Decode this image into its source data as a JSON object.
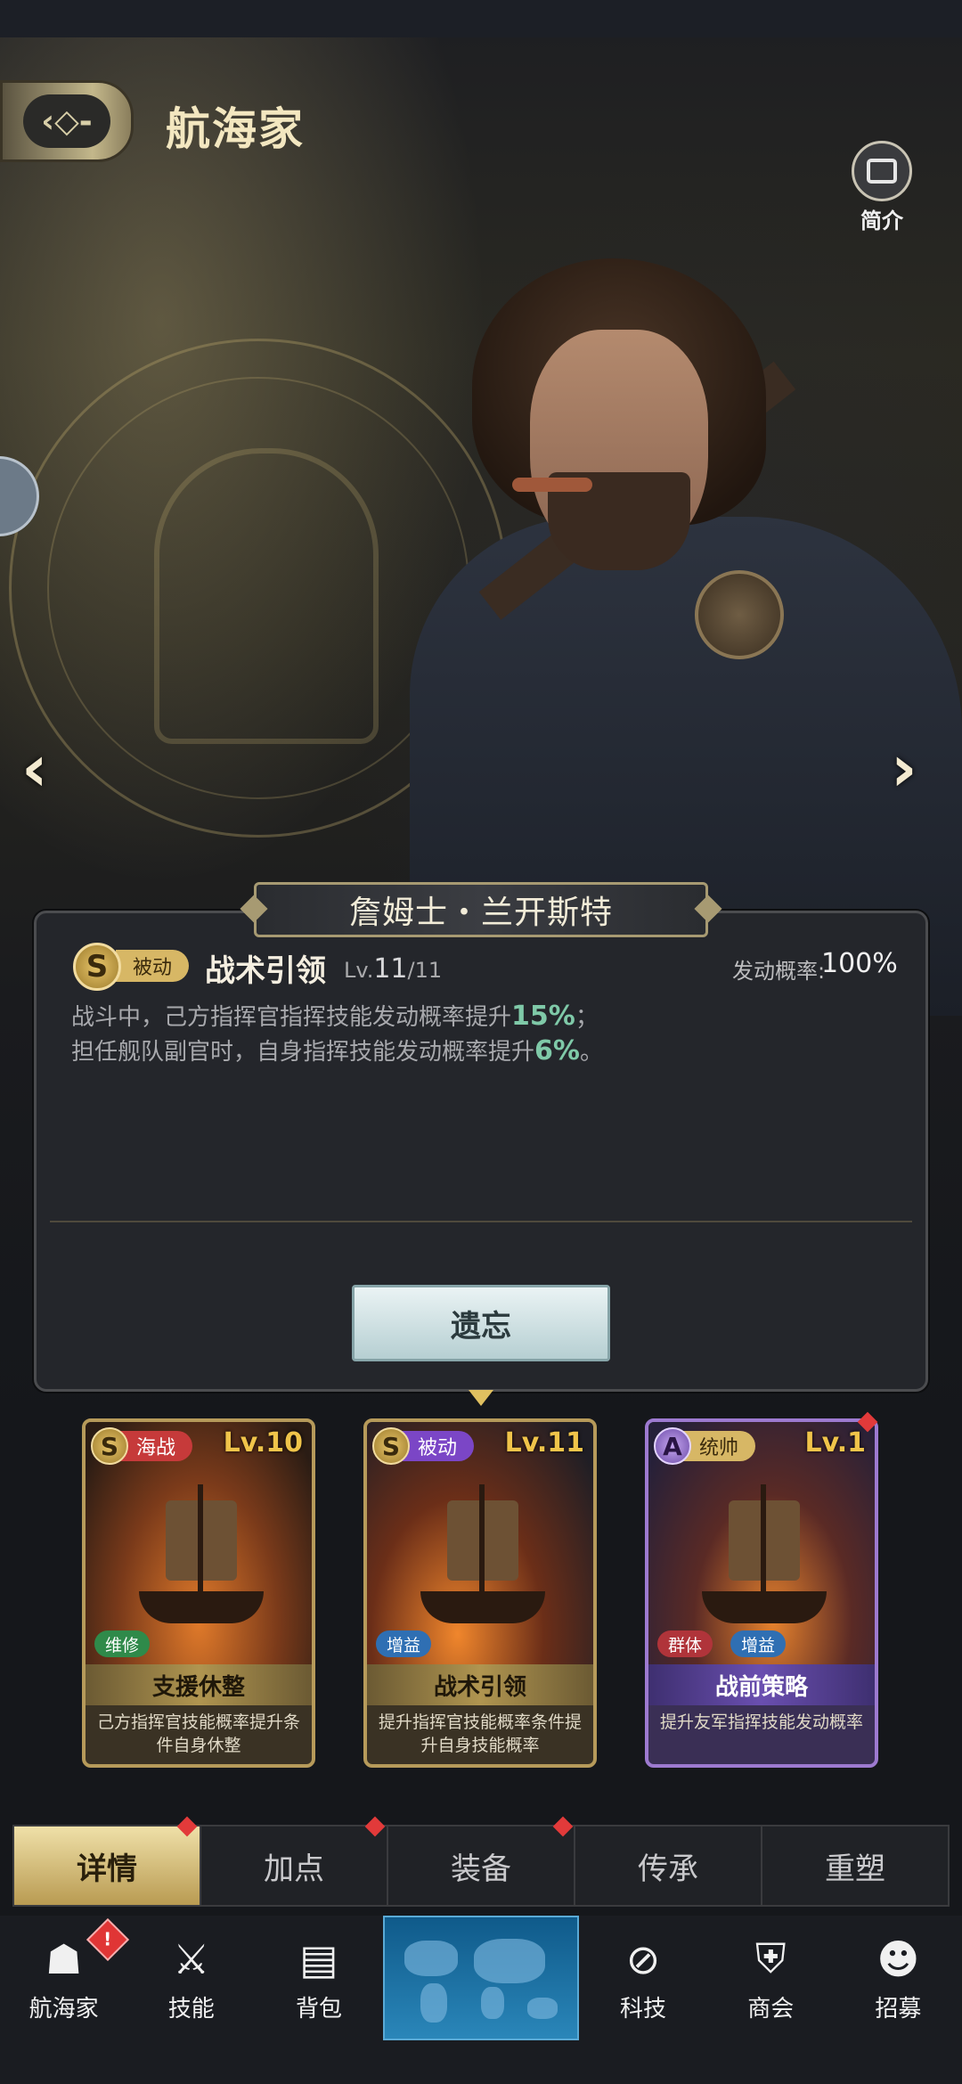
{
  "header": {
    "title": "航海家",
    "intro_label": "简介"
  },
  "commander": {
    "name": "詹姆士・兰开斯特"
  },
  "skill_detail": {
    "grade": "S",
    "type": "被动",
    "name": "战术引领",
    "level_prefix": "Lv.",
    "level": "11",
    "level_max": "/11",
    "rate_label": "发动概率:",
    "rate": "100%",
    "desc_line1_a": "战斗中，己方指挥官指挥技能发动概率提升",
    "desc_line1_val": "15%",
    "desc_line1_b": "；",
    "desc_line2_a": "担任舰队副官时，自身指挥技能发动概率提升",
    "desc_line2_val": "6%",
    "desc_line2_b": "。",
    "forget_button": "遗忘"
  },
  "skill_cards": [
    {
      "grade": "S",
      "type": "海战",
      "level": "Lv.10",
      "tags": [
        "维修"
      ],
      "name": "支援休整",
      "desc": "己方指挥官技能概率提升条件自身休整"
    },
    {
      "grade": "S",
      "type": "被动",
      "level": "Lv.11",
      "tags": [
        "增益"
      ],
      "name": "战术引领",
      "desc": "提升指挥官技能概率条件提升自身技能概率"
    },
    {
      "grade": "A",
      "type": "统帅",
      "level": "Lv.1",
      "tags": [
        "群体",
        "增益"
      ],
      "name": "战前策略",
      "desc": "提升友军指挥技能发动概率"
    }
  ],
  "tabs": [
    "详情",
    "加点",
    "装备",
    "传承",
    "重塑"
  ],
  "active_tab": "详情",
  "bottom_nav": [
    {
      "label": "航海家",
      "icon": "captain-hat-icon"
    },
    {
      "label": "技能",
      "icon": "crossed-swords-icon"
    },
    {
      "label": "背包",
      "icon": "backpack-icon"
    },
    {
      "label": "",
      "icon": "world-map-icon"
    },
    {
      "label": "科技",
      "icon": "tech-icon"
    },
    {
      "label": "商会",
      "icon": "guild-shield-icon"
    },
    {
      "label": "招募",
      "icon": "recruit-icon"
    }
  ],
  "colors": {
    "accent_gold": "#d7b765",
    "highlight_green": "#7fc9a8",
    "notice_red": "#e23a3a"
  }
}
